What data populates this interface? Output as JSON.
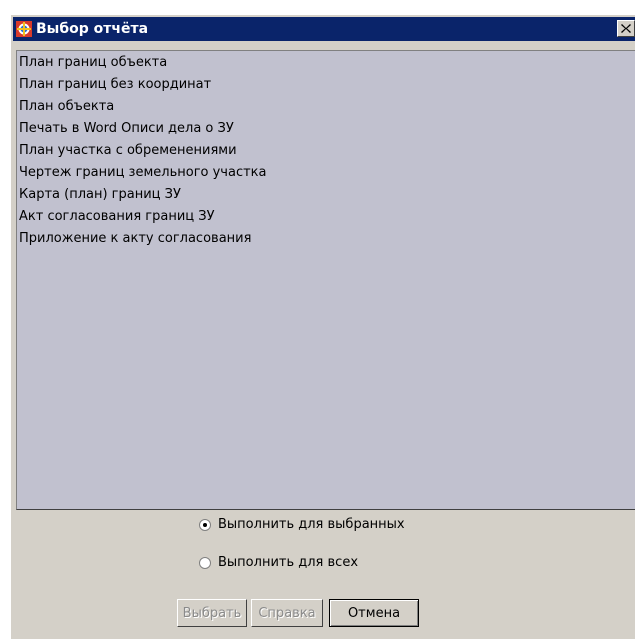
{
  "window": {
    "title": "Выбор отчёта",
    "title_bar_color": "#0a246a",
    "background_color": "#d4d0c8"
  },
  "report_list": {
    "background_color": "#c1c1cf",
    "items": [
      "План границ объекта",
      "План границ без координат",
      "План объекта",
      "Печать в Word Описи дела о ЗУ",
      "План участка с обременениями",
      "Чертеж границ земельного участка",
      "Карта (план) границ ЗУ",
      "Акт согласования границ ЗУ",
      "Приложение к акту согласования"
    ]
  },
  "options": {
    "run_selected_label": "Выполнить для выбранных",
    "run_selected_checked": true,
    "run_all_label": "Выполнить для всех",
    "run_all_checked": false
  },
  "buttons": {
    "select_label": "Выбрать",
    "select_enabled": false,
    "help_label": "Справка",
    "help_enabled": false,
    "cancel_label": "Отмена",
    "cancel_enabled": true
  }
}
